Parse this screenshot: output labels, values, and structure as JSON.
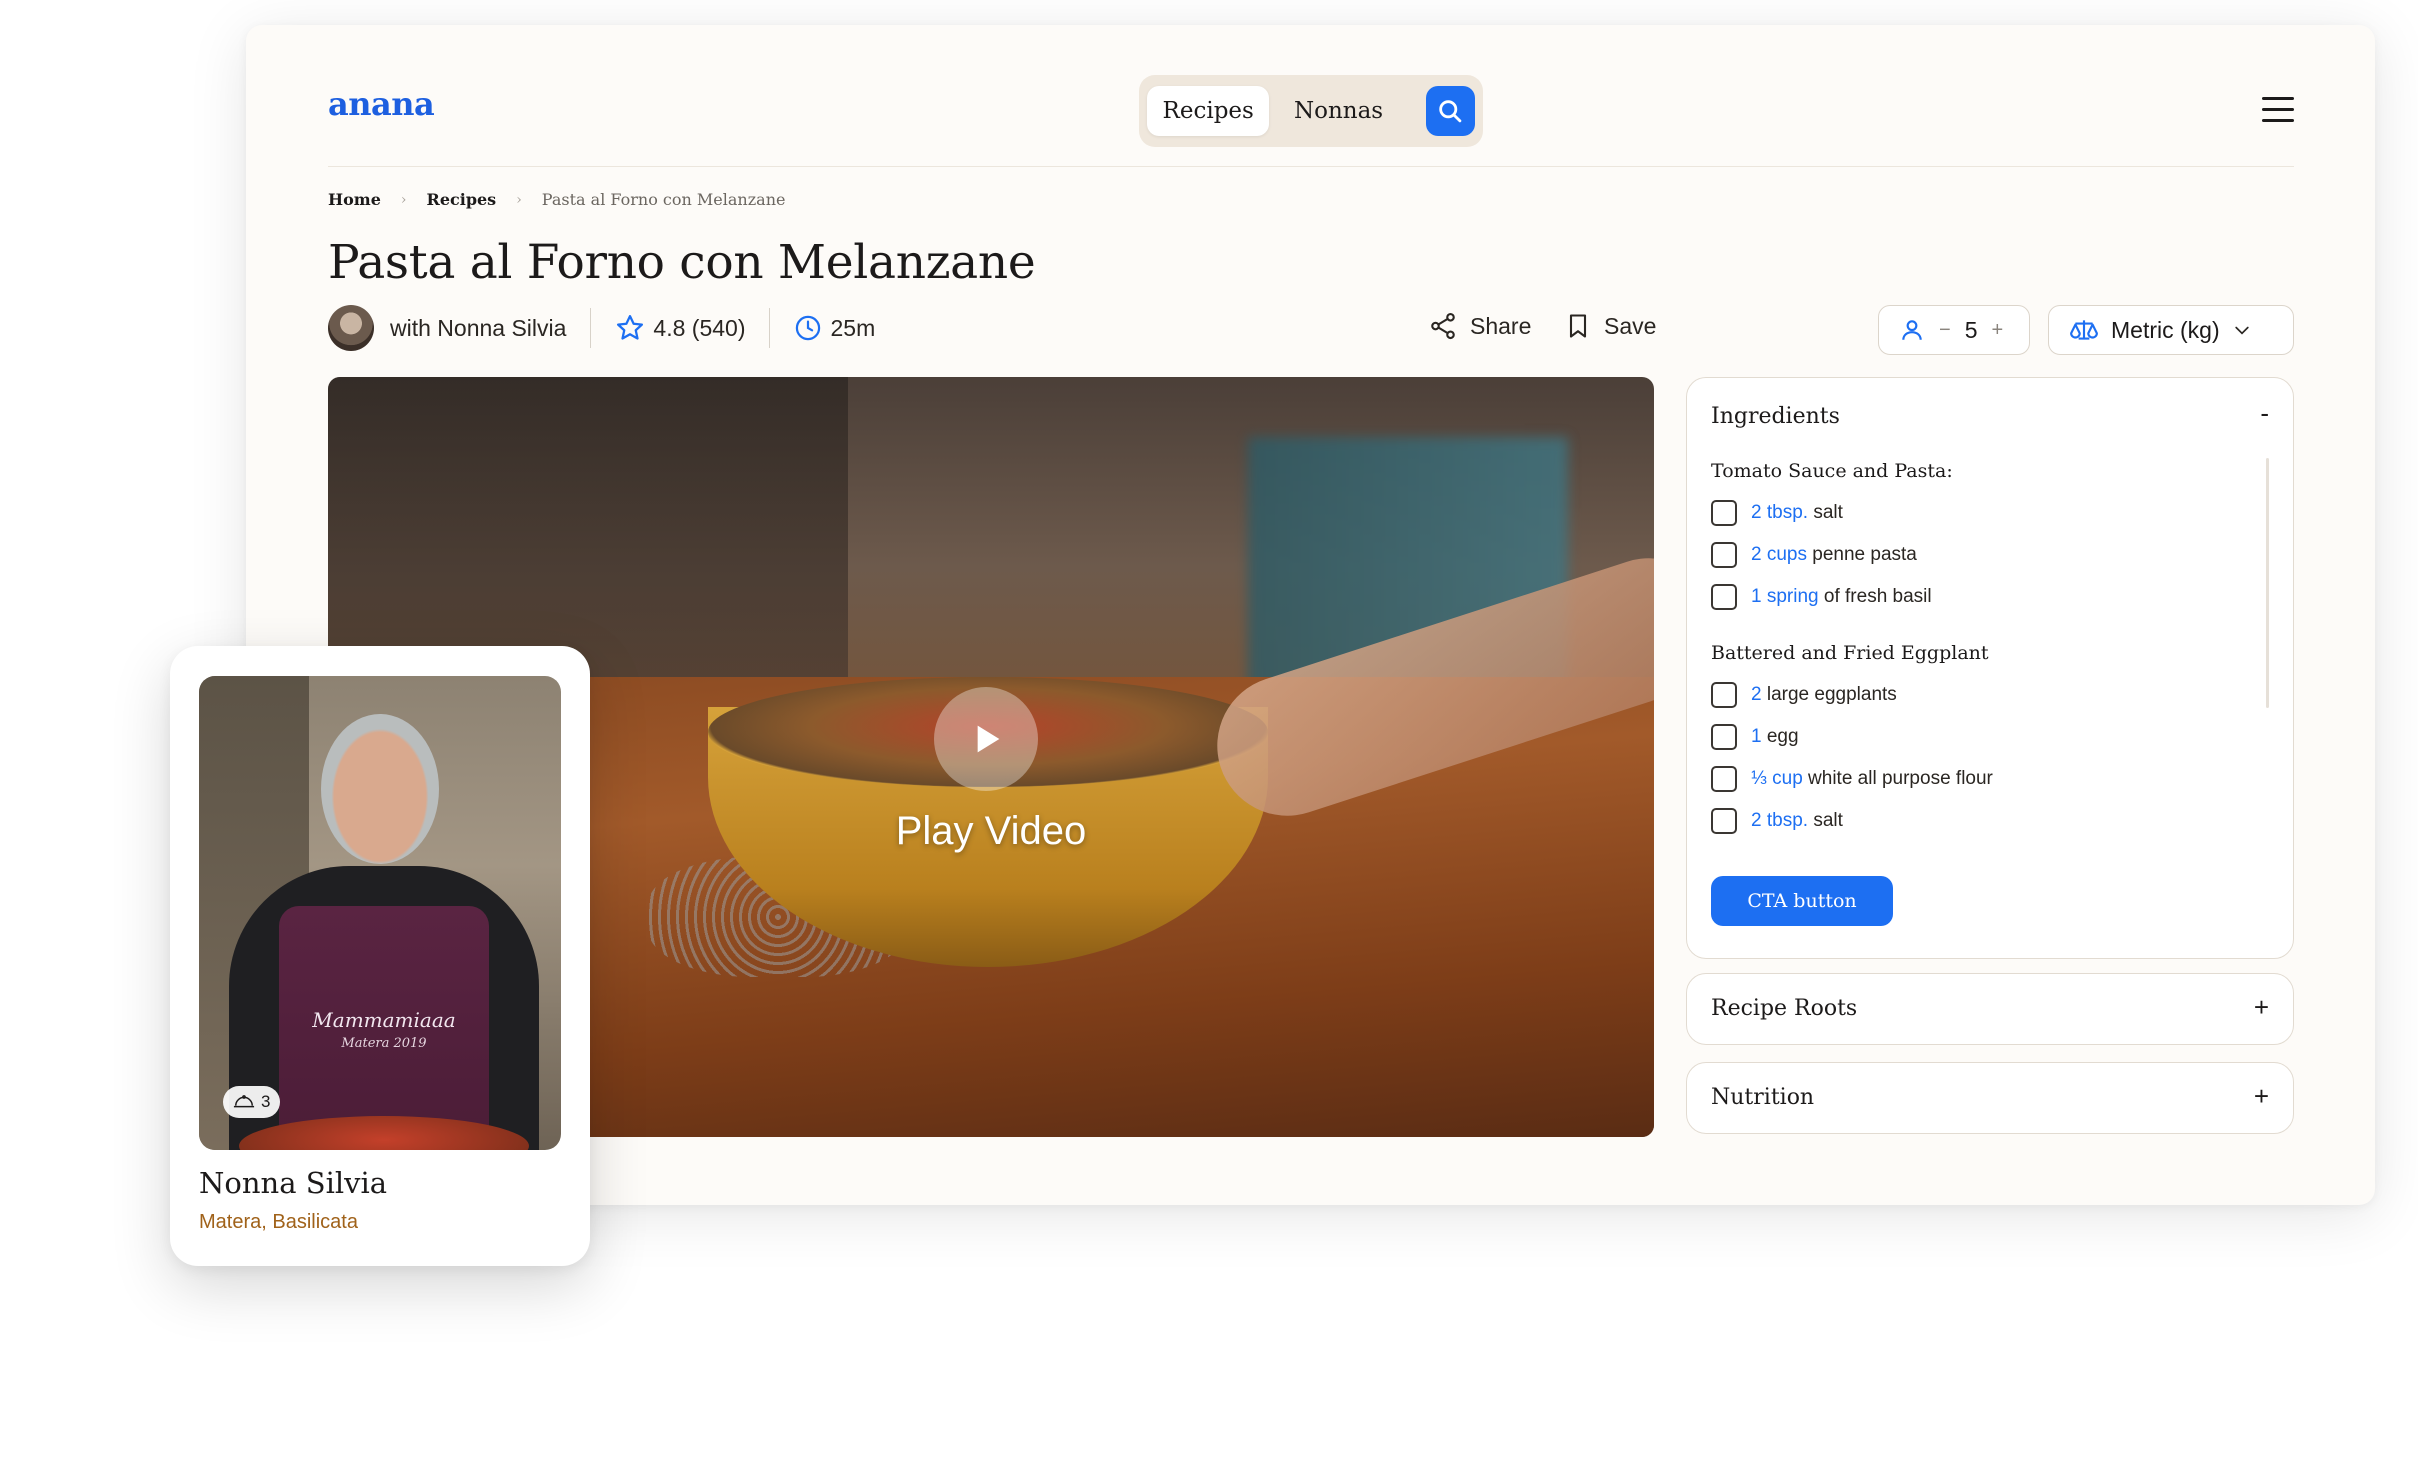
{
  "header": {
    "logo": "anana",
    "nav_tabs": [
      {
        "label": "Recipes",
        "active": true
      },
      {
        "label": "Nonnas",
        "active": false
      }
    ],
    "search_icon": "search-icon",
    "menu_icon": "hamburger-menu-icon"
  },
  "breadcrumb": [
    "Home",
    "Recipes",
    "Pasta al Forno con Melanzane"
  ],
  "recipe": {
    "title": "Pasta al Forno con Melanzane",
    "author": "with Nonna Silvia",
    "rating": "4.8 (540)",
    "time": "25m",
    "share_label": "Share",
    "save_label": "Save",
    "servings": "5",
    "servings_minus": "−",
    "servings_plus": "+",
    "unit": "Metric (kg)"
  },
  "video": {
    "play_label": "Play Video"
  },
  "ingredients": {
    "title": "Ingredients",
    "toggle": "-",
    "sections": [
      {
        "title": "Tomato Sauce and Pasta:",
        "items": [
          {
            "qty": "2 tbsp.",
            "name": "salt"
          },
          {
            "qty": "2 cups",
            "name": "penne pasta"
          },
          {
            "qty": "1 spring",
            "name": "of fresh basil"
          }
        ]
      },
      {
        "title": "Battered and Fried Eggplant",
        "items": [
          {
            "qty": "2",
            "name": "large eggplants"
          },
          {
            "qty": "1",
            "name": "egg"
          },
          {
            "qty": "⅓ cup",
            "name": "white all purpose flour"
          },
          {
            "qty": "2 tbsp.",
            "name": "salt"
          }
        ]
      }
    ],
    "cta": "CTA button"
  },
  "accordions": [
    {
      "title": "Recipe Roots",
      "toggle": "+"
    },
    {
      "title": "Nutrition",
      "toggle": "+"
    }
  ],
  "nonna_card": {
    "name": "Nonna Silvia",
    "location": "Matera, Basilicata",
    "badge_count": "3",
    "apron_text": "Mammamiaaa",
    "apron_subtext": "Matera 2019"
  },
  "colors": {
    "brand_blue": "#1d6ff2",
    "location_brown": "#a0621a",
    "nav_pill_bg": "#efe7dc"
  }
}
